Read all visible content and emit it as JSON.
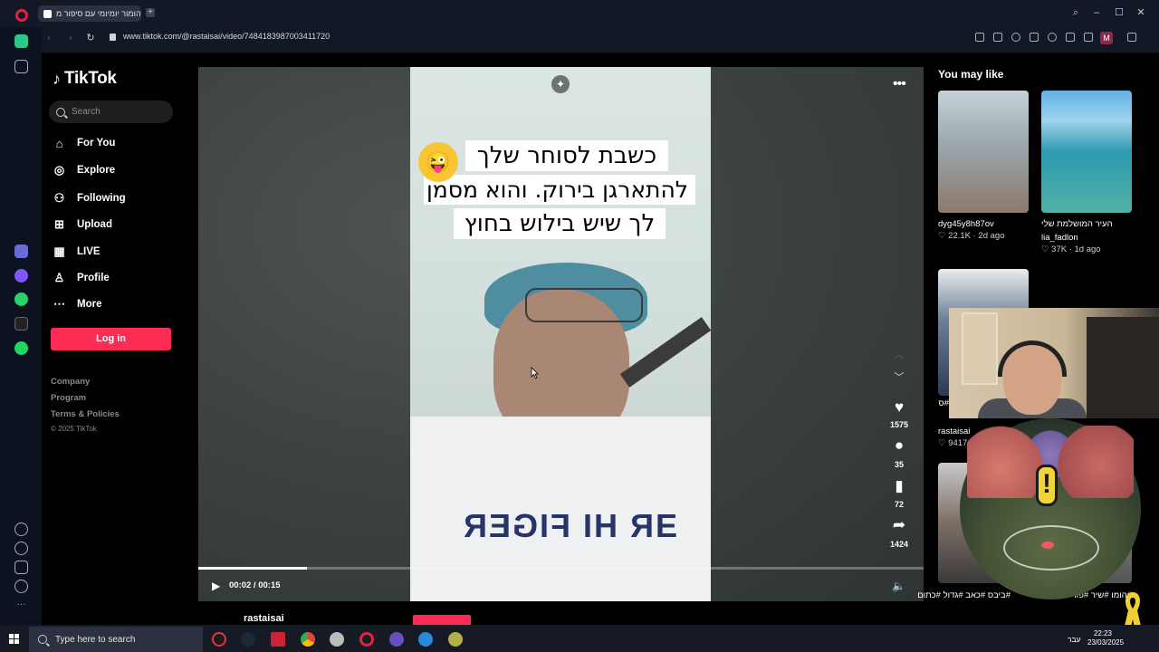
{
  "browser": {
    "tab_title": "הומור יומיומי עם סיפור מ...",
    "url": "www.tiktok.com/@rastaisai/video/7484183987003411720",
    "profile_letter": "M"
  },
  "tiktok": {
    "logo_text": "TikTok",
    "search_placeholder": "Search",
    "nav": [
      {
        "label": "For You",
        "icon": "home-icon"
      },
      {
        "label": "Explore",
        "icon": "compass-icon"
      },
      {
        "label": "Following",
        "icon": "person-icon"
      },
      {
        "label": "Upload",
        "icon": "plus-square-icon"
      },
      {
        "label": "LIVE",
        "icon": "live-icon"
      },
      {
        "label": "Profile",
        "icon": "profile-icon"
      },
      {
        "label": "More",
        "icon": "more-dots-icon"
      }
    ],
    "login_label": "Log in",
    "footer": [
      "Company",
      "Program",
      "Terms & Policies"
    ],
    "copyright": "© 2025 TikTok"
  },
  "video": {
    "caption_lines": [
      "כשבת לסוחר שלך",
      "להתארגן בירוק. והוא מסמן",
      "לך שיש בילוש בחוץ"
    ],
    "shirt_text": "ƎR HI FIGER",
    "actions": [
      {
        "name": "like",
        "icon": "heart-icon",
        "count": "1575"
      },
      {
        "name": "comment",
        "icon": "comment-icon",
        "count": "35"
      },
      {
        "name": "save",
        "icon": "bookmark-icon",
        "count": "72"
      },
      {
        "name": "share",
        "icon": "share-icon",
        "count": "1424"
      }
    ],
    "time": "00:02 / 00:15",
    "progress_fraction": 0.15,
    "author": "rastaisai"
  },
  "right": {
    "heading": "You may like",
    "items": [
      {
        "author": "dyg45y8h87ov",
        "likes": "22.1K",
        "age": "2d ago"
      },
      {
        "title": "העיר המושלמת שלי",
        "author": "lia_fadlon",
        "likes": "37K",
        "age": "1d ago"
      },
      {
        "author": "rastaisai",
        "likes": "9417",
        "tags": "#סרטים #תו"
      },
      {
        "tags": "#ביבס #כאב #גדול #כתום"
      },
      {
        "tags": "#הומו #שיר #פורים"
      }
    ]
  },
  "taskbar": {
    "search_placeholder": "Type here to search",
    "lang": "עבר",
    "time": "22:23",
    "date": "23/03/2025"
  }
}
